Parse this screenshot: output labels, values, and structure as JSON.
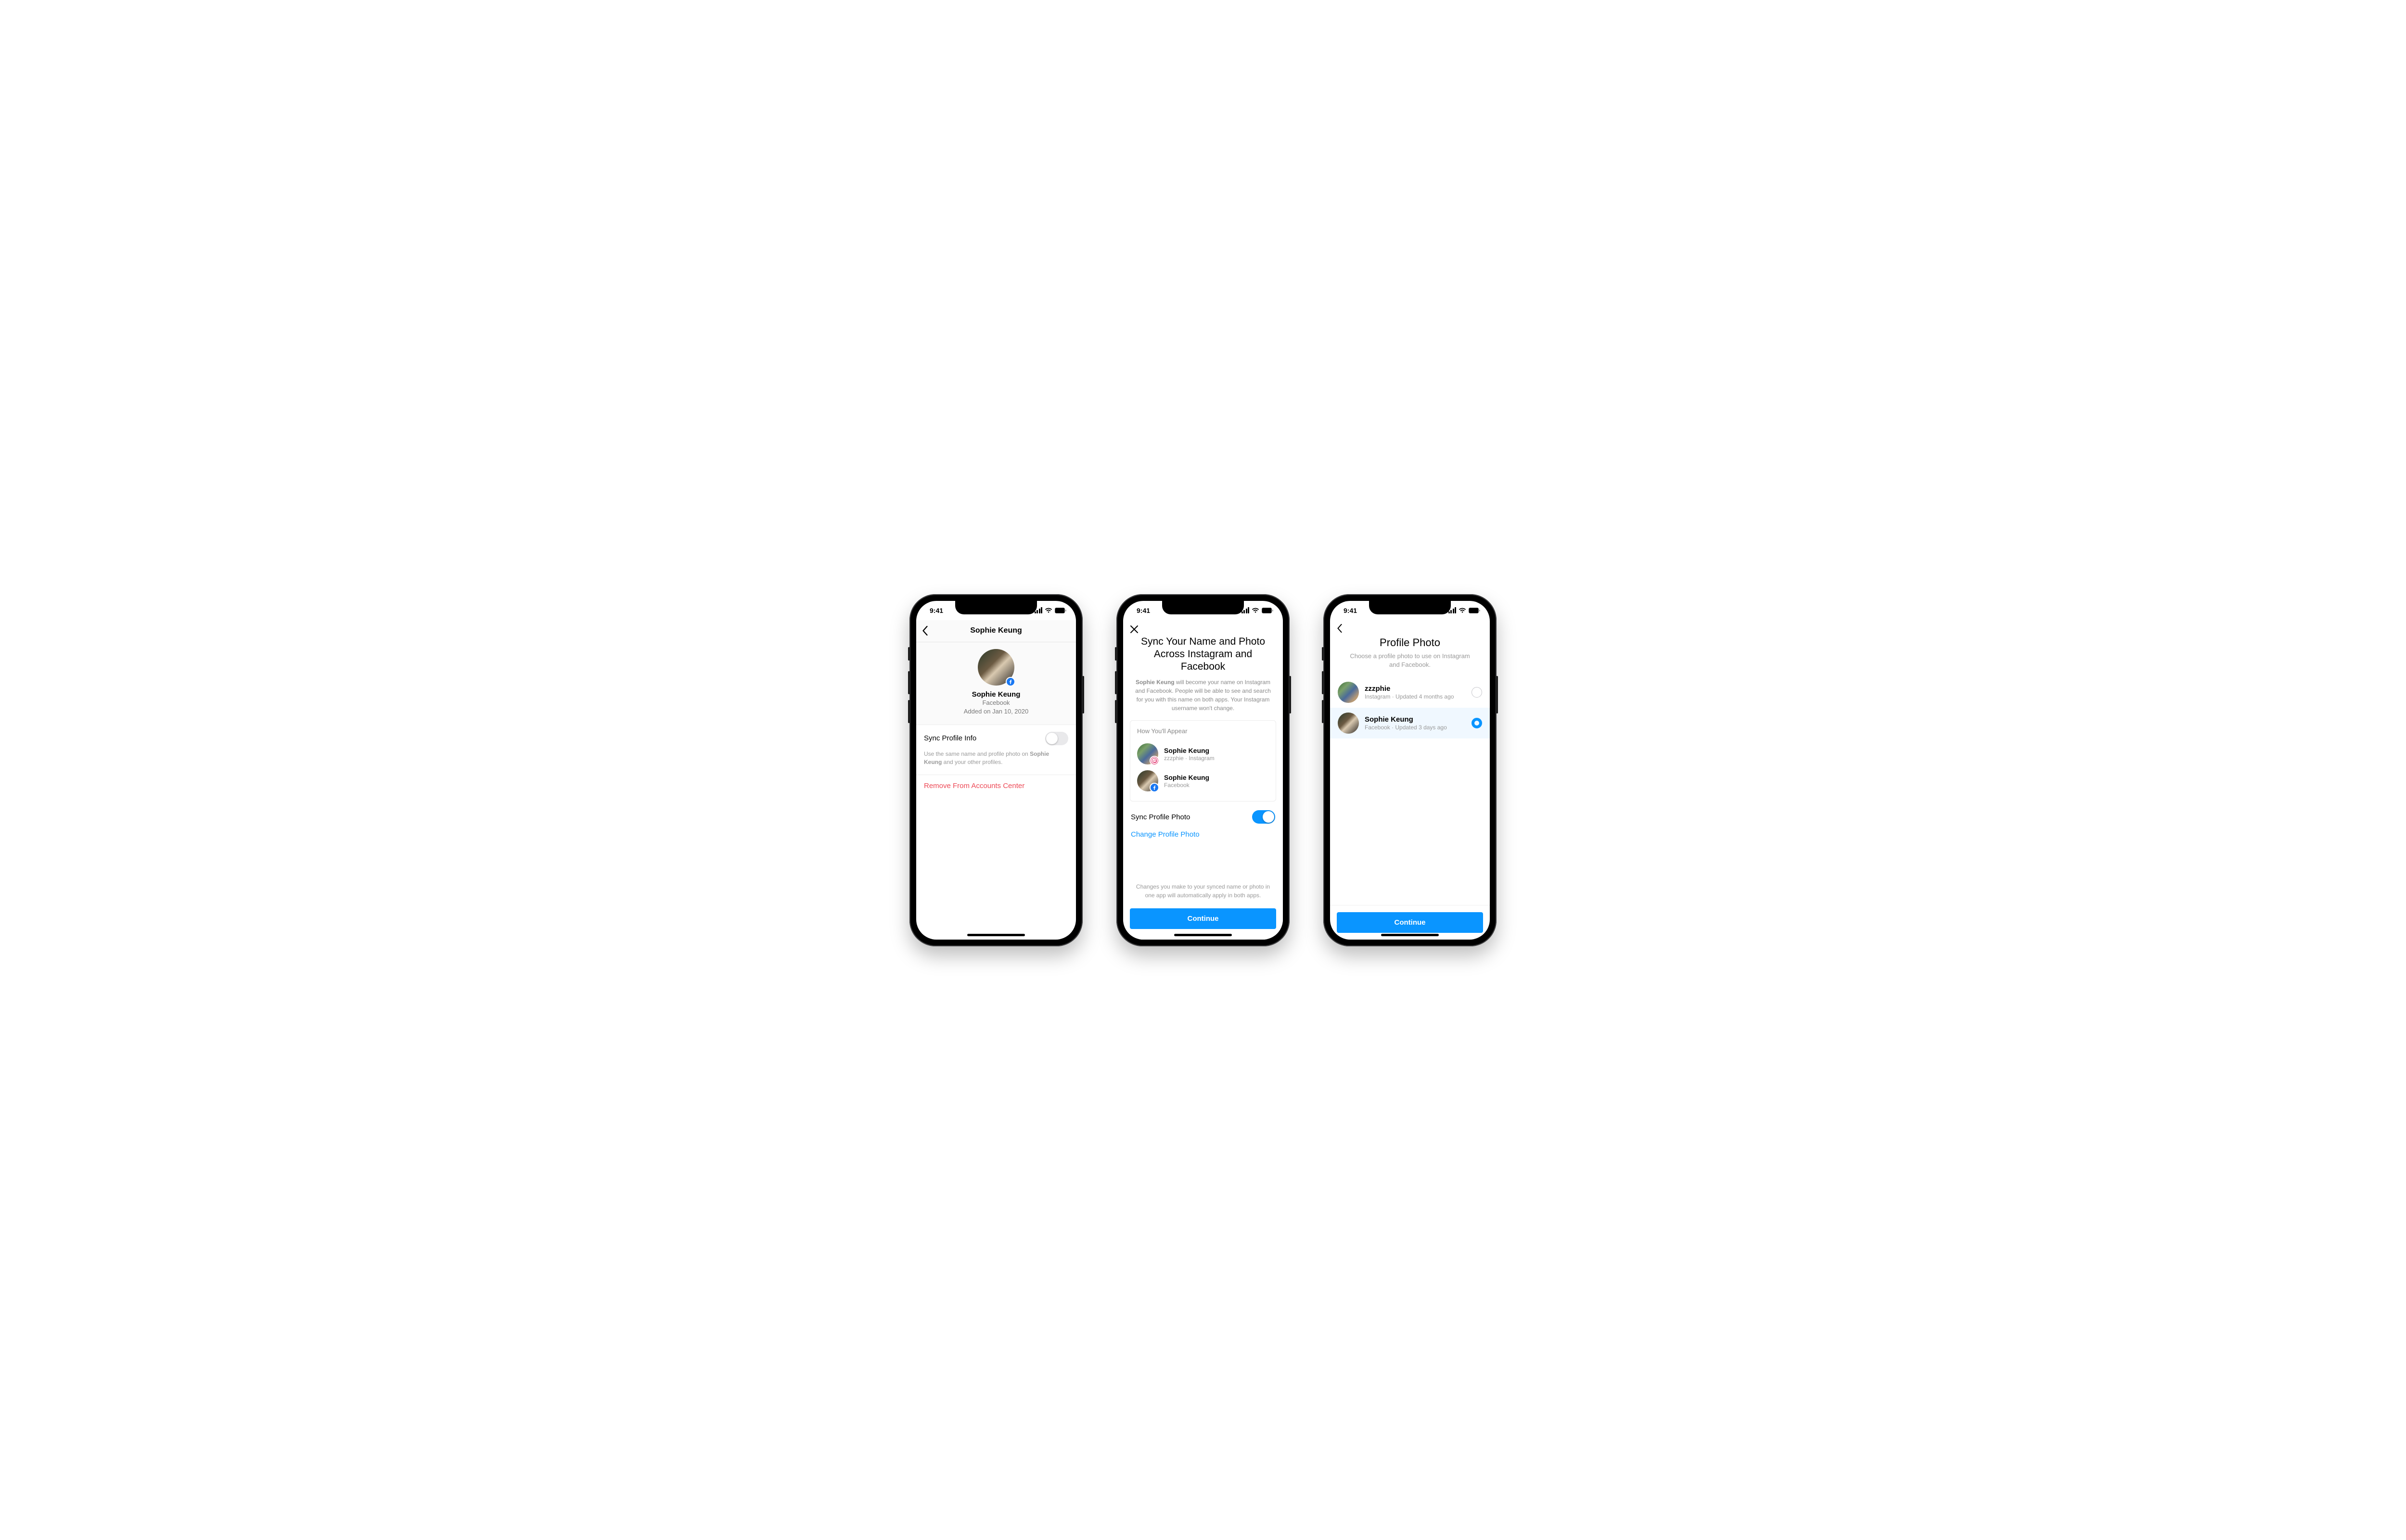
{
  "status": {
    "time": "9:41"
  },
  "screen1": {
    "header_title": "Sophie Keung",
    "profile_name": "Sophie Keung",
    "profile_platform": "Facebook",
    "profile_added": "Added on Jan 10, 2020",
    "toggle_label": "Sync Profile Info",
    "toggle_on": false,
    "help_prefix": "Use the same name and profile photo on ",
    "help_bold": "Sophie Keung",
    "help_suffix": " and your other profiles.",
    "remove_label": "Remove From Accounts Center"
  },
  "screen2": {
    "title": "Sync Your Name and Photo Across Instagram and Facebook",
    "desc_bold": "Sophie Keung",
    "desc_rest": " will become your name on Instagram and Facebook. People will be able to see and search for you with this name on both apps. Your Instagram username won't change.",
    "card_title": "How You'll Appear",
    "entry1_name": "Sophie Keung",
    "entry1_sub": "zzzphie · Instagram",
    "entry2_name": "Sophie Keung",
    "entry2_sub": "Facebook",
    "toggle_label": "Sync Profile Photo",
    "toggle_on": true,
    "change_link": "Change Profile Photo",
    "footer_note": "Changes you make to your synced name or photo in one app will automatically apply in both apps.",
    "continue_label": "Continue"
  },
  "screen3": {
    "title": "Profile Photo",
    "desc": "Choose a profile photo to use on Instagram and Facebook.",
    "option1_name": "zzzphie",
    "option1_sub": "Instagram · Updated 4 months ago",
    "option1_selected": false,
    "option2_name": "Sophie Keung",
    "option2_sub": "Facebook · Updated 3 days ago",
    "option2_selected": true,
    "continue_label": "Continue"
  }
}
